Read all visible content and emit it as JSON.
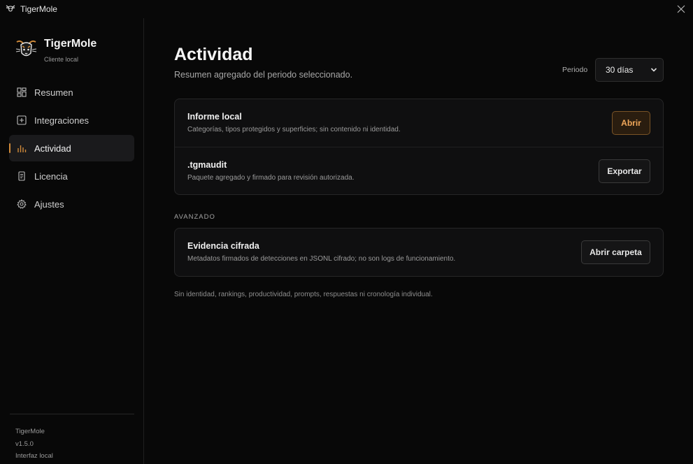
{
  "window": {
    "title": "TigerMole"
  },
  "brand": {
    "name": "TigerMole",
    "subtitle": "Cliente local"
  },
  "nav": {
    "items": [
      {
        "label": "Resumen",
        "icon": "dashboard-icon",
        "active": false
      },
      {
        "label": "Integraciones",
        "icon": "plus-square-icon",
        "active": false
      },
      {
        "label": "Actividad",
        "icon": "bar-chart-icon",
        "active": true
      },
      {
        "label": "Licencia",
        "icon": "document-icon",
        "active": false
      },
      {
        "label": "Ajustes",
        "icon": "gear-icon",
        "active": false
      }
    ]
  },
  "sidebar_footer": {
    "app": "TigerMole",
    "version": "v1.5.0",
    "mode": "Interfaz local"
  },
  "page": {
    "title": "Actividad",
    "subtitle": "Resumen agregado del periodo seleccionado.",
    "period_label": "Periodo",
    "period_value": "30 días"
  },
  "reports": {
    "rows": [
      {
        "title": "Informe local",
        "description": "Categorías, tipos protegidos y superficies; sin contenido ni identidad.",
        "button": "Abrir"
      },
      {
        "title": ".tgmaudit",
        "description": "Paquete agregado y firmado para revisión autorizada.",
        "button": "Exportar"
      }
    ]
  },
  "advanced": {
    "label": "AVANZADO",
    "title": "Evidencia cifrada",
    "description": "Metadatos firmados de detecciones en JSONL cifrado; no son logs de funcionamiento.",
    "button": "Abrir carpeta"
  },
  "footnote": "Sin identidad, rankings, productividad, prompts, respuestas ni cronología individual.",
  "colors": {
    "accent": "#d08a3a",
    "background": "#080808",
    "card": "#0f0f10"
  }
}
